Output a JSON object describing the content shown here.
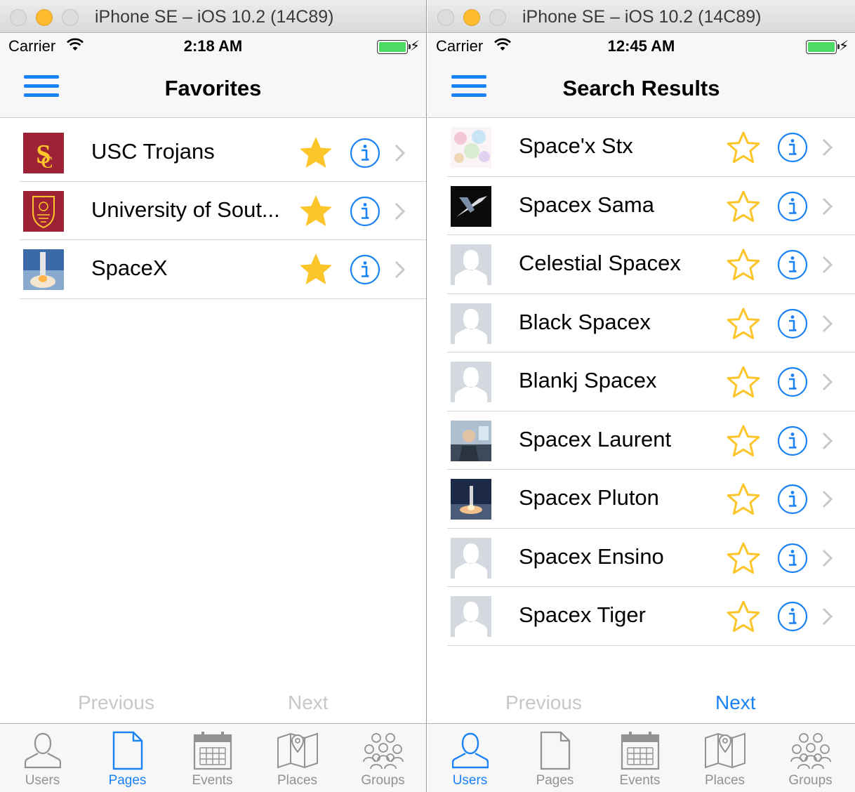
{
  "colors": {
    "tint": "#1a82f5",
    "star": "#fcc52a",
    "disabled": "#c7c7cc",
    "battery": "#4cd964"
  },
  "left": {
    "window_title": "iPhone SE – iOS 10.2 (14C89)",
    "status": {
      "carrier": "Carrier",
      "time": "2:18 AM"
    },
    "nav_title": "Favorites",
    "rows": [
      {
        "label": "USC Trojans",
        "thumb": "usc-logo",
        "favorited": true
      },
      {
        "label": "University of Sout...",
        "thumb": "usc-seal",
        "favorited": true
      },
      {
        "label": "SpaceX",
        "thumb": "rocket-photo",
        "favorited": true
      }
    ],
    "pager": {
      "previous": "Previous",
      "next": "Next",
      "previous_enabled": false,
      "next_enabled": false
    },
    "tabs": [
      {
        "label": "Users",
        "icon": "user-icon",
        "active": false
      },
      {
        "label": "Pages",
        "icon": "page-icon",
        "active": true
      },
      {
        "label": "Events",
        "icon": "calendar-icon",
        "active": false
      },
      {
        "label": "Places",
        "icon": "map-icon",
        "active": false
      },
      {
        "label": "Groups",
        "icon": "group-icon",
        "active": false
      }
    ]
  },
  "right": {
    "window_title": "iPhone SE – iOS 10.2 (14C89)",
    "status": {
      "carrier": "Carrier",
      "time": "12:45 AM"
    },
    "nav_title": "Search Results",
    "rows": [
      {
        "label": "Space'x Stx",
        "thumb": "pastel-collage",
        "favorited": false
      },
      {
        "label": "Spacex Sama",
        "thumb": "spacex-x-logo",
        "favorited": false
      },
      {
        "label": "Celestial Spacex",
        "thumb": "default-avatar",
        "favorited": false
      },
      {
        "label": "Black Spacex",
        "thumb": "default-avatar",
        "favorited": false
      },
      {
        "label": "Blankj Spacex",
        "thumb": "default-avatar",
        "favorited": false
      },
      {
        "label": "Spacex Laurent",
        "thumb": "person-photo",
        "favorited": false
      },
      {
        "label": "Spacex Pluton",
        "thumb": "rocket-landing-photo",
        "favorited": false
      },
      {
        "label": "Spacex Ensino",
        "thumb": "default-avatar",
        "favorited": false
      },
      {
        "label": "Spacex Tiger",
        "thumb": "default-avatar",
        "favorited": false
      }
    ],
    "pager": {
      "previous": "Previous",
      "next": "Next",
      "previous_enabled": false,
      "next_enabled": true
    },
    "tabs": [
      {
        "label": "Users",
        "icon": "user-icon",
        "active": true
      },
      {
        "label": "Pages",
        "icon": "page-icon",
        "active": false
      },
      {
        "label": "Events",
        "icon": "calendar-icon",
        "active": false
      },
      {
        "label": "Places",
        "icon": "map-icon",
        "active": false
      },
      {
        "label": "Groups",
        "icon": "group-icon",
        "active": false
      }
    ]
  }
}
